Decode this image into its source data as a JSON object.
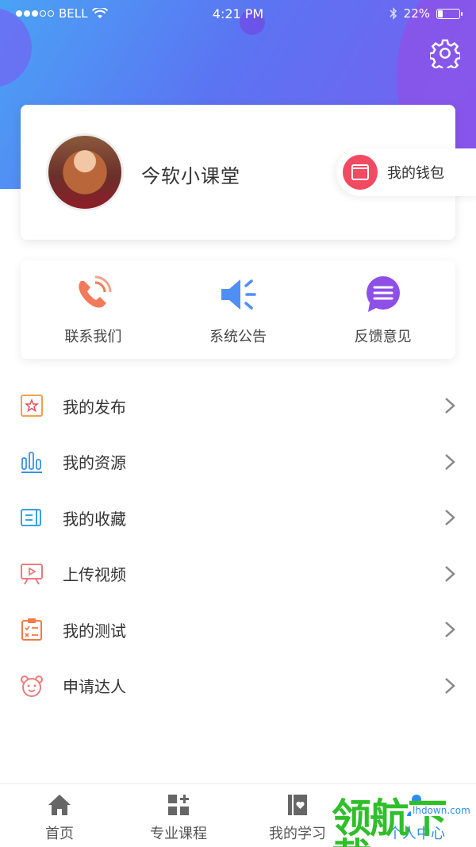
{
  "status_bar": {
    "carrier": "BELL",
    "time": "4:21 PM",
    "battery": "22%",
    "battery_level": 0.22
  },
  "profile": {
    "name": "今软小课堂",
    "wallet_label": "我的钱包"
  },
  "quick_actions": [
    {
      "label": "联系我们",
      "icon": "phone-icon",
      "color": "#f2795a"
    },
    {
      "label": "系统公告",
      "icon": "speaker-icon",
      "color": "#4f8ff5"
    },
    {
      "label": "反馈意见",
      "icon": "message-icon",
      "color": "#8e4fe8"
    }
  ],
  "menu": [
    {
      "label": "我的发布",
      "icon": "star-icon",
      "color": "#f5a14a"
    },
    {
      "label": "我的资源",
      "icon": "bar-chart-icon",
      "color": "#3a8fe8"
    },
    {
      "label": "我的收藏",
      "icon": "bookmark-icon",
      "color": "#3aa0e8"
    },
    {
      "label": "上传视频",
      "icon": "video-icon",
      "color": "#f0787f"
    },
    {
      "label": "我的测试",
      "icon": "clipboard-icon",
      "color": "#f07a4a"
    },
    {
      "label": "申请达人",
      "icon": "bear-icon",
      "color": "#f07a7a"
    }
  ],
  "tabbar": [
    {
      "label": "首页",
      "icon": "home-icon"
    },
    {
      "label": "专业课程",
      "icon": "grid-plus-icon"
    },
    {
      "label": "我的学习",
      "icon": "book-heart-icon"
    },
    {
      "label": "个人中心",
      "icon": "person-icon",
      "active": true
    }
  ],
  "watermark": {
    "text": "领航下载",
    "url": "lhdown.com"
  }
}
